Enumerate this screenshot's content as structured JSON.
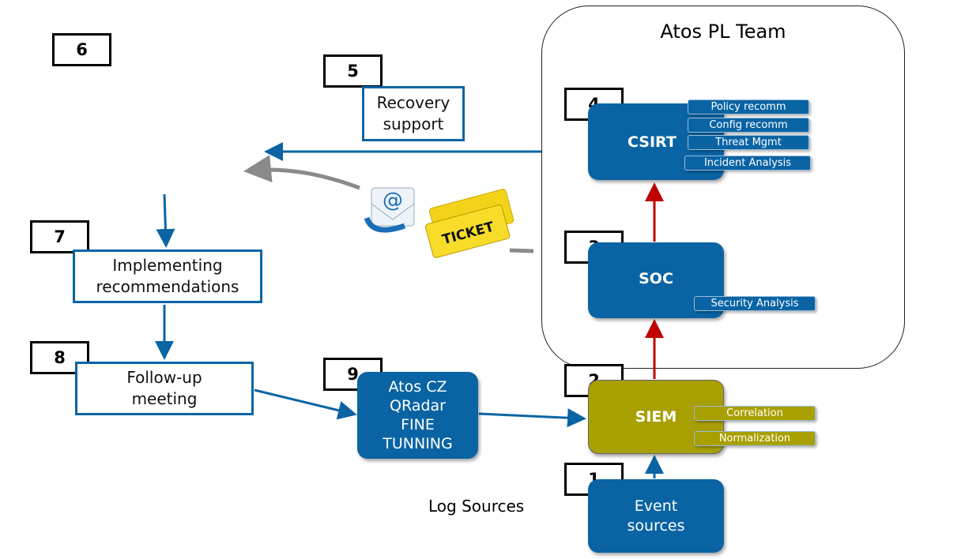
{
  "team": {
    "title": "Atos PL Team"
  },
  "numbers": [
    "1",
    "2",
    "3",
    "4",
    "5",
    "6",
    "7",
    "8",
    "9"
  ],
  "boxes": {
    "recovery": "Recovery support",
    "implementing": "Implementing recommendations",
    "followup": "Follow-up meeting",
    "csirt": "CSIRT",
    "soc": "SOC",
    "siem": "SIEM",
    "event_sources": "Event sources",
    "atos_cz": "Atos CZ QRadar FINE TUNNING"
  },
  "csirt_tabs": [
    "Policy recomm",
    "Config recomm",
    "Threat Mgmt",
    "Incident Analysis"
  ],
  "soc_tabs": [
    "Security Analysis"
  ],
  "siem_tabs": [
    "Correlation",
    "Normalization"
  ],
  "labels": {
    "log_sources": "Log Sources"
  },
  "icons": {
    "email": "email-icon",
    "ticket": "ticket-icon",
    "ticket_text": "TICKET"
  },
  "colors": {
    "blue": "#0a64a4",
    "olive": "#a8a000",
    "red_arrow": "#c00000",
    "gray_arrow": "#8a8a8a"
  }
}
